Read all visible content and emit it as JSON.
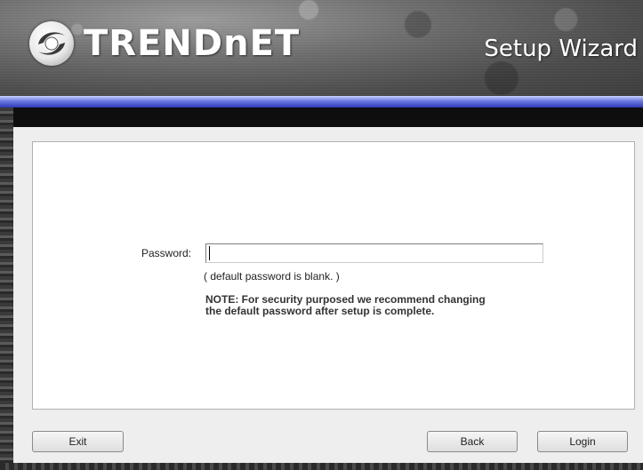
{
  "header": {
    "brand": "TRENDnET",
    "title": "Setup Wizard",
    "logo_icon": "trendnet-swirl-logo-icon"
  },
  "form": {
    "password_label": "Password:",
    "password_value": "",
    "hint": "( default password is blank.  )",
    "note": "NOTE: For security purposed we recommend changing the default password after setup is complete."
  },
  "buttons": {
    "exit": "Exit",
    "back": "Back",
    "login": "Login"
  },
  "colors": {
    "accent_bar": "#4a58d0",
    "panel_bg": "#eeeeee"
  }
}
